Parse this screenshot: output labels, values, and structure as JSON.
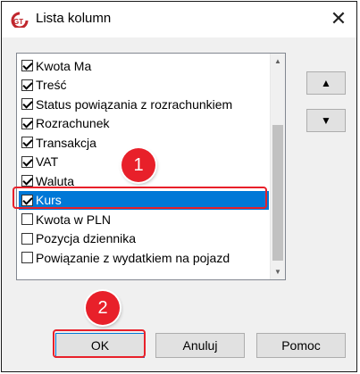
{
  "window": {
    "title": "Lista kolumn",
    "close_label": "✕"
  },
  "list": {
    "items": [
      {
        "label": "Kwota Ma",
        "checked": true
      },
      {
        "label": "Treść",
        "checked": true
      },
      {
        "label": "Status powiązania z rozrachunkiem",
        "checked": true
      },
      {
        "label": "Rozrachunek",
        "checked": true
      },
      {
        "label": "Transakcja",
        "checked": true
      },
      {
        "label": "VAT",
        "checked": true
      },
      {
        "label": "Waluta",
        "checked": true
      },
      {
        "label": "Kurs",
        "checked": true,
        "selected": true
      },
      {
        "label": "Kwota w PLN",
        "checked": false
      },
      {
        "label": "Pozycja dziennika",
        "checked": false
      },
      {
        "label": "Powiązanie z wydatkiem na pojazd",
        "checked": false
      }
    ]
  },
  "move": {
    "up_label": "▲",
    "down_label": "▼"
  },
  "buttons": {
    "ok": "OK",
    "cancel": "Anuluj",
    "help": "Pomoc"
  },
  "annotations": {
    "badge1": "1",
    "badge2": "2",
    "color": "#e8202a"
  },
  "colors": {
    "selection": "#0078d7",
    "accent": "#e8202a"
  }
}
